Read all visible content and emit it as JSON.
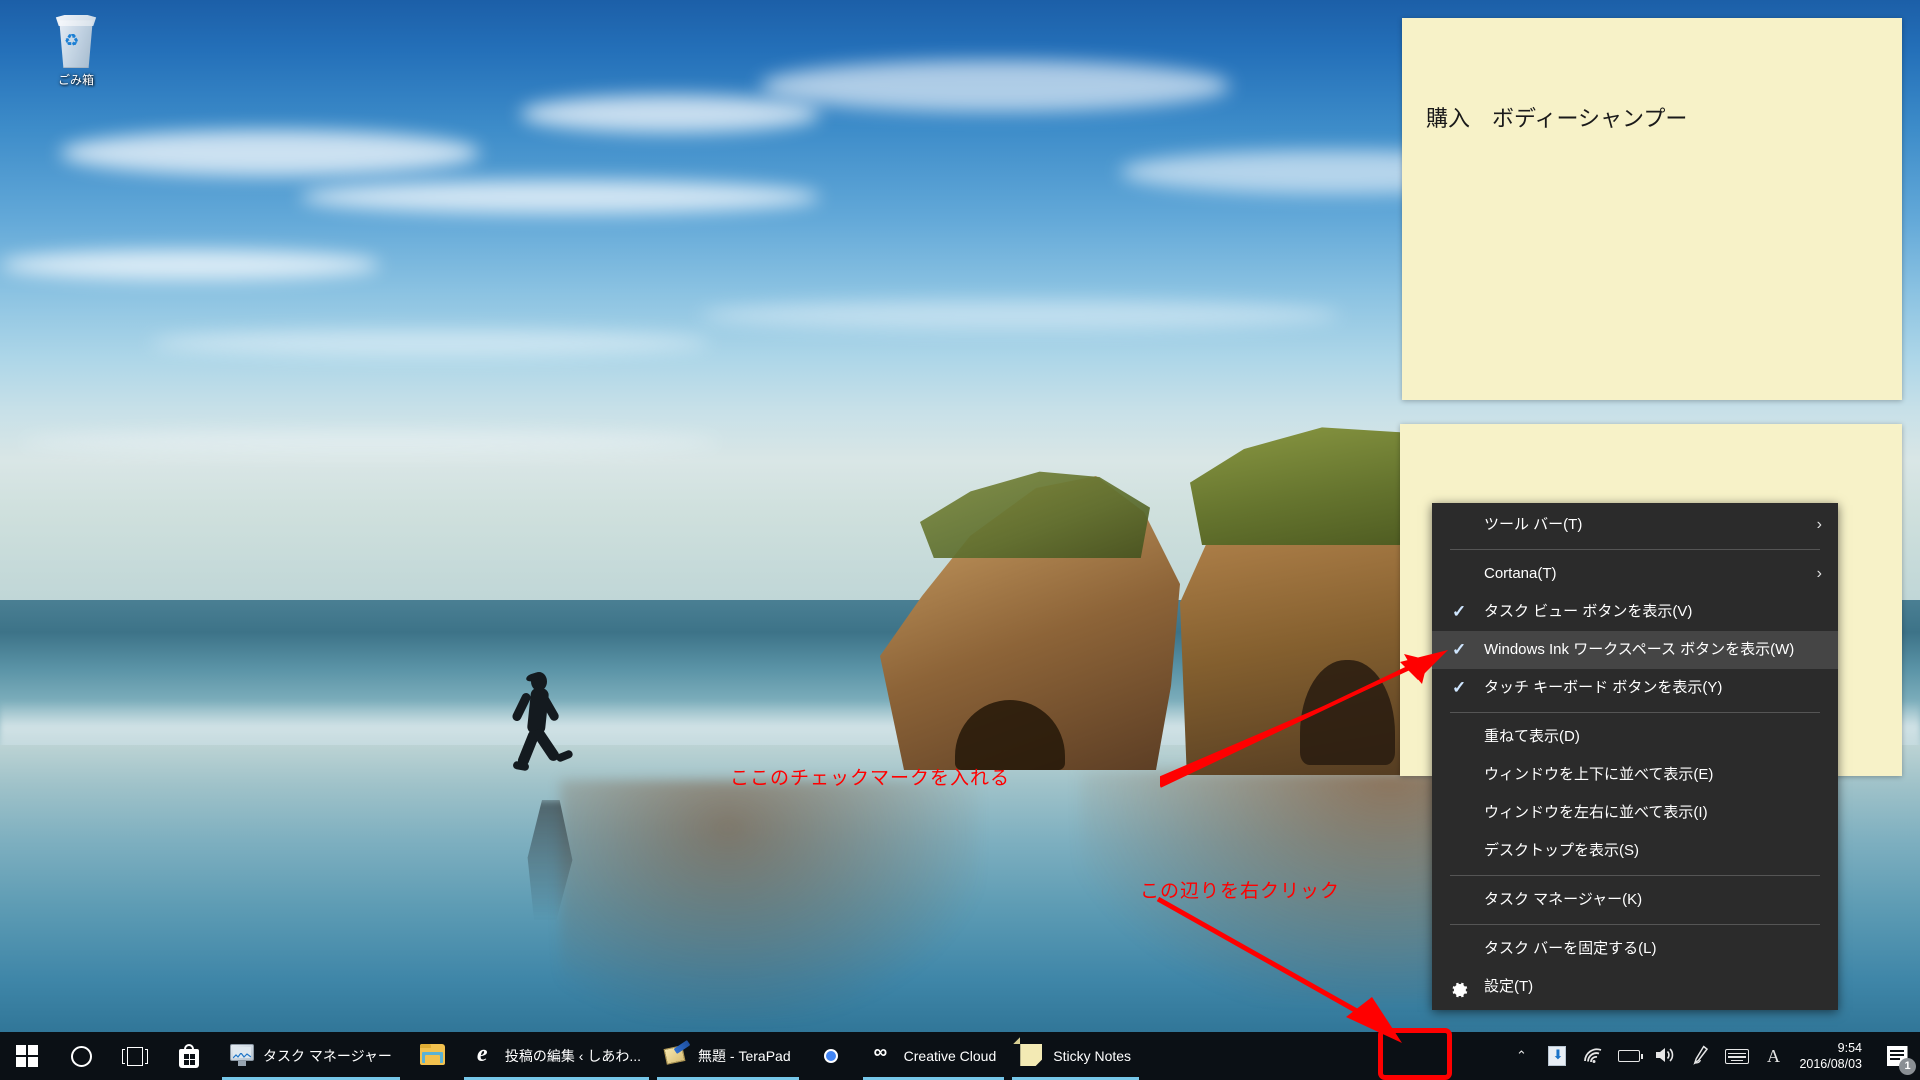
{
  "desktop": {
    "recycle_bin": {
      "label": "ごみ箱",
      "icon": "recycle-bin-icon"
    }
  },
  "sticky_notes": [
    {
      "id": "note-1",
      "text": "購入　ボディーシャンプー"
    },
    {
      "id": "note-2",
      "text": ""
    }
  ],
  "context_menu": {
    "title": "taskbar-context-menu",
    "hovered_item_index": 3,
    "items": [
      {
        "label": "ツール バー(T)",
        "checked": false,
        "submenu": true,
        "separator_after": true,
        "icon": null
      },
      {
        "label": "Cortana(T)",
        "checked": false,
        "submenu": true,
        "separator_after": false,
        "icon": null
      },
      {
        "label": "タスク ビュー ボタンを表示(V)",
        "checked": true,
        "submenu": false,
        "separator_after": false,
        "icon": null
      },
      {
        "label": "Windows Ink ワークスペース ボタンを表示(W)",
        "checked": true,
        "submenu": false,
        "separator_after": false,
        "icon": null
      },
      {
        "label": "タッチ キーボード ボタンを表示(Y)",
        "checked": true,
        "submenu": false,
        "separator_after": true,
        "icon": null
      },
      {
        "label": "重ねて表示(D)",
        "checked": false,
        "submenu": false,
        "separator_after": false,
        "icon": null
      },
      {
        "label": "ウィンドウを上下に並べて表示(E)",
        "checked": false,
        "submenu": false,
        "separator_after": false,
        "icon": null
      },
      {
        "label": "ウィンドウを左右に並べて表示(I)",
        "checked": false,
        "submenu": false,
        "separator_after": false,
        "icon": null
      },
      {
        "label": "デスクトップを表示(S)",
        "checked": false,
        "submenu": false,
        "separator_after": true,
        "icon": null
      },
      {
        "label": "タスク マネージャー(K)",
        "checked": false,
        "submenu": false,
        "separator_after": true,
        "icon": null
      },
      {
        "label": "タスク バーを固定する(L)",
        "checked": false,
        "submenu": false,
        "separator_after": false,
        "icon": null
      },
      {
        "label": "設定(T)",
        "checked": false,
        "submenu": false,
        "separator_after": false,
        "icon": "gear-icon"
      }
    ],
    "submenu_arrow": "›",
    "check_glyph": "✓"
  },
  "taskbar": {
    "start_button": {
      "name": "start-button",
      "icon": "windows-logo-icon"
    },
    "cortana_button": {
      "name": "cortana-button",
      "icon": "cortana-circle-icon"
    },
    "task_view_button": {
      "name": "task-view-button",
      "icon": "task-view-icon"
    },
    "apps": [
      {
        "label": "",
        "icon": "microsoft-store-icon",
        "pinned": true,
        "running": false
      },
      {
        "label": "タスク マネージャー",
        "icon": "task-manager-icon",
        "pinned": false,
        "running": true
      },
      {
        "label": "",
        "icon": "file-explorer-icon",
        "pinned": true,
        "running": false
      },
      {
        "label": "投稿の編集 ‹ しあわ...",
        "icon": "microsoft-edge-icon",
        "pinned": false,
        "running": true
      },
      {
        "label": "無題 - TeraPad",
        "icon": "terapad-icon",
        "pinned": false,
        "running": true
      },
      {
        "label": "",
        "icon": "google-chrome-icon",
        "pinned": true,
        "running": false
      },
      {
        "label": "Creative Cloud",
        "icon": "adobe-creative-cloud-icon",
        "pinned": false,
        "running": true
      },
      {
        "label": "Sticky Notes",
        "icon": "sticky-notes-icon",
        "pinned": false,
        "running": true
      }
    ],
    "systray": [
      {
        "name": "show-hidden-icons-button",
        "icon": "chevron-up-icon",
        "glyph": "⌃"
      },
      {
        "name": "updater-tray-icon",
        "icon": "download-arrow-icon",
        "glyph": ""
      },
      {
        "name": "network-tray-icon",
        "icon": "wifi-icon",
        "glyph": ""
      },
      {
        "name": "battery-tray-icon",
        "icon": "battery-icon",
        "glyph": ""
      },
      {
        "name": "volume-tray-icon",
        "icon": "speaker-icon",
        "glyph": "🔊"
      },
      {
        "name": "windows-ink-tray-icon",
        "icon": "pen-icon",
        "glyph": "✒"
      },
      {
        "name": "touch-keyboard-button",
        "icon": "keyboard-icon",
        "glyph": ""
      },
      {
        "name": "ime-mode-indicator",
        "icon": "ime-a-icon",
        "glyph": "A"
      }
    ],
    "clock": {
      "time": "9:54",
      "date": "2016/08/03"
    },
    "notifications": {
      "name": "action-center-button",
      "badge": "1",
      "icon": "notification-icon"
    }
  },
  "annotations": [
    {
      "name": "annotation-check-mark",
      "text": "ここのチェックマークを入れる",
      "color": "#ff0000"
    },
    {
      "name": "annotation-right-click",
      "text": "この辺りを右クリック",
      "color": "#ff0000"
    }
  ],
  "colors": {
    "menu_background": "#2b2b2b",
    "menu_hover": "#454545",
    "taskbar": "#0b1015",
    "sticky_note": "#f7f2c8",
    "accent": "#76c6e8",
    "annotation_red": "#ff0000"
  }
}
